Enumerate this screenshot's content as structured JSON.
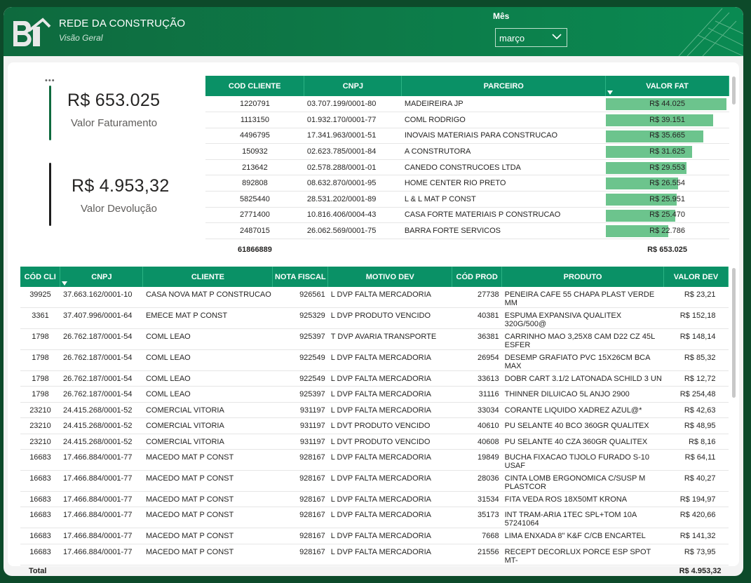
{
  "header": {
    "title": "REDE DA CONSTRUÇÃO",
    "subtitle": "Visão Geral",
    "logo_text": "BI",
    "month_label": "Mês",
    "month_value": "março"
  },
  "kpis": {
    "menu": "•••",
    "revenue_value": "R$ 653.025",
    "revenue_label": "Valor Faturamento",
    "return_value": "R$ 4.953,32",
    "return_label": "Valor Devolução"
  },
  "colors": {
    "accent": "#0a9166",
    "bar": "#6cc48d",
    "header_bg": "#0e6a3e"
  },
  "clients_table": {
    "headers": [
      "COD CLIENTE",
      "CNPJ",
      "PARCEIRO",
      "VALOR FAT"
    ],
    "rows": [
      {
        "cod": "1220791",
        "cnpj": "03.707.199/0001-80",
        "parceiro": "MADEIREIRA JP",
        "valor": "R$ 44.025",
        "v": 44025
      },
      {
        "cod": "1113150",
        "cnpj": "01.932.170/0001-77",
        "parceiro": "COML RODRIGO",
        "valor": "R$ 39.151",
        "v": 39151
      },
      {
        "cod": "4496795",
        "cnpj": "17.341.963/0001-51",
        "parceiro": "INOVAIS MATERIAIS PARA CONSTRUCAO",
        "valor": "R$ 35.665",
        "v": 35665
      },
      {
        "cod": "150932",
        "cnpj": "02.623.785/0001-84",
        "parceiro": "A CONSTRUTORA",
        "valor": "R$ 31.625",
        "v": 31625
      },
      {
        "cod": "213642",
        "cnpj": "02.578.288/0001-01",
        "parceiro": "CANEDO CONSTRUCOES LTDA",
        "valor": "R$ 29.553",
        "v": 29553
      },
      {
        "cod": "892808",
        "cnpj": "08.632.870/0001-95",
        "parceiro": "HOME CENTER RIO PRETO",
        "valor": "R$ 26.554",
        "v": 26554
      },
      {
        "cod": "5825440",
        "cnpj": "28.531.202/0001-89",
        "parceiro": "L & L MAT P CONST",
        "valor": "R$ 25.951",
        "v": 25951
      },
      {
        "cod": "2771400",
        "cnpj": "10.816.406/0004-43",
        "parceiro": "CASA FORTE MATERIAIS P CONSTRUCAO",
        "valor": "R$ 25.470",
        "v": 25470
      },
      {
        "cod": "2487015",
        "cnpj": "26.062.569/0001-75",
        "parceiro": "BARRA FORTE SERVICOS",
        "valor": "R$ 22.786",
        "v": 22786
      }
    ],
    "total_cod": "61866889",
    "total_valor": "R$ 653.025"
  },
  "returns_table": {
    "headers": [
      "CÓD CLI",
      "CNPJ",
      "CLIENTE",
      "NOTA FISCAL",
      "MOTIVO DEV",
      "CÓD PROD",
      "PRODUTO",
      "VALOR DEV"
    ],
    "rows": [
      [
        "39925",
        "37.663.162/0001-10",
        "CASA NOVA MAT P CONSTRUCAO",
        "926561",
        "L DVP FALTA MERCADORIA",
        "27738",
        "PENEIRA CAFE 55 CHAPA PLAST VERDE MM",
        "R$ 23,21"
      ],
      [
        "3361",
        "37.407.996/0001-64",
        "EMECE MAT P CONST",
        "925329",
        "L DVP PRODUTO VENCIDO",
        "40381",
        "ESPUMA EXPANSIVA QUALITEX 320G/500@",
        "R$ 152,18"
      ],
      [
        "1798",
        "26.762.187/0001-54",
        "COML LEAO",
        "925397",
        "T DVP AVARIA TRANSPORTE",
        "36381",
        "CARRINHO MAO 3,25X8 CAM D22 CZ 45L ESFER",
        "R$ 148,14"
      ],
      [
        "1798",
        "26.762.187/0001-54",
        "COML LEAO",
        "922549",
        "L DVP FALTA MERCADORIA",
        "26954",
        "DESEMP GRAFIATO PVC 15X26CM BCA MAX",
        "R$ 85,32"
      ],
      [
        "1798",
        "26.762.187/0001-54",
        "COML LEAO",
        "922549",
        "L DVP FALTA MERCADORIA",
        "33613",
        "DOBR CART 3.1/2 LATONADA SCHILD 3 UN",
        "R$ 12,72"
      ],
      [
        "1798",
        "26.762.187/0001-54",
        "COML LEAO",
        "925397",
        "L DVP FALTA MERCADORIA",
        "31116",
        "THINNER DILUICAO 5L ANJO 2900",
        "R$ 254,48"
      ],
      [
        "23210",
        "24.415.268/0001-52",
        "COMERCIAL VITORIA",
        "931197",
        "L DVP FALTA MERCADORIA",
        "33034",
        "CORANTE LIQUIDO XADREZ AZUL@*",
        "R$ 42,63"
      ],
      [
        "23210",
        "24.415.268/0001-52",
        "COMERCIAL VITORIA",
        "931197",
        "L DVT PRODUTO VENCIDO",
        "40610",
        "PU SELANTE 40 BCO 360GR QUALITEX",
        "R$ 48,95"
      ],
      [
        "23210",
        "24.415.268/0001-52",
        "COMERCIAL VITORIA",
        "931197",
        "L DVT PRODUTO VENCIDO",
        "40608",
        "PU SELANTE 40 CZA 360GR QUALITEX",
        "R$ 8,16"
      ],
      [
        "16683",
        "17.466.884/0001-77",
        "MACEDO MAT P CONST",
        "928167",
        "L DVP FALTA MERCADORIA",
        "19849",
        "BUCHA FIXACAO TIJOLO FURADO S-10 USAF",
        "R$ 64,11"
      ],
      [
        "16683",
        "17.466.884/0001-77",
        "MACEDO MAT P CONST",
        "928167",
        "L DVP FALTA MERCADORIA",
        "28036",
        "CINTA LOMB ERGONOMICA C/SUSP M PLASTCOR",
        "R$ 40,27"
      ],
      [
        "16683",
        "17.466.884/0001-77",
        "MACEDO MAT P CONST",
        "928167",
        "L DVP FALTA MERCADORIA",
        "31534",
        "FITA VEDA ROS 18X50MT KRONA",
        "R$ 194,97"
      ],
      [
        "16683",
        "17.466.884/0001-77",
        "MACEDO MAT P CONST",
        "928167",
        "L DVP FALTA MERCADORIA",
        "35173",
        "INT TRAM-ARIA 1TEC SPL+TOM 10A 57241064",
        "R$ 420,66"
      ],
      [
        "16683",
        "17.466.884/0001-77",
        "MACEDO MAT P CONST",
        "928167",
        "L DVP FALTA MERCADORIA",
        "7668",
        "LIMA ENXADA 8\" K&F C/CB ENCARTEL",
        "R$ 141,32"
      ],
      [
        "16683",
        "17.466.884/0001-77",
        "MACEDO MAT P CONST",
        "928167",
        "L DVP FALTA MERCADORIA",
        "21556",
        "RECEPT DECORLUX PORCE ESP SPOT MT-",
        "R$ 73,95"
      ]
    ],
    "total_label": "Total",
    "total_value": "R$ 4.953,32"
  }
}
